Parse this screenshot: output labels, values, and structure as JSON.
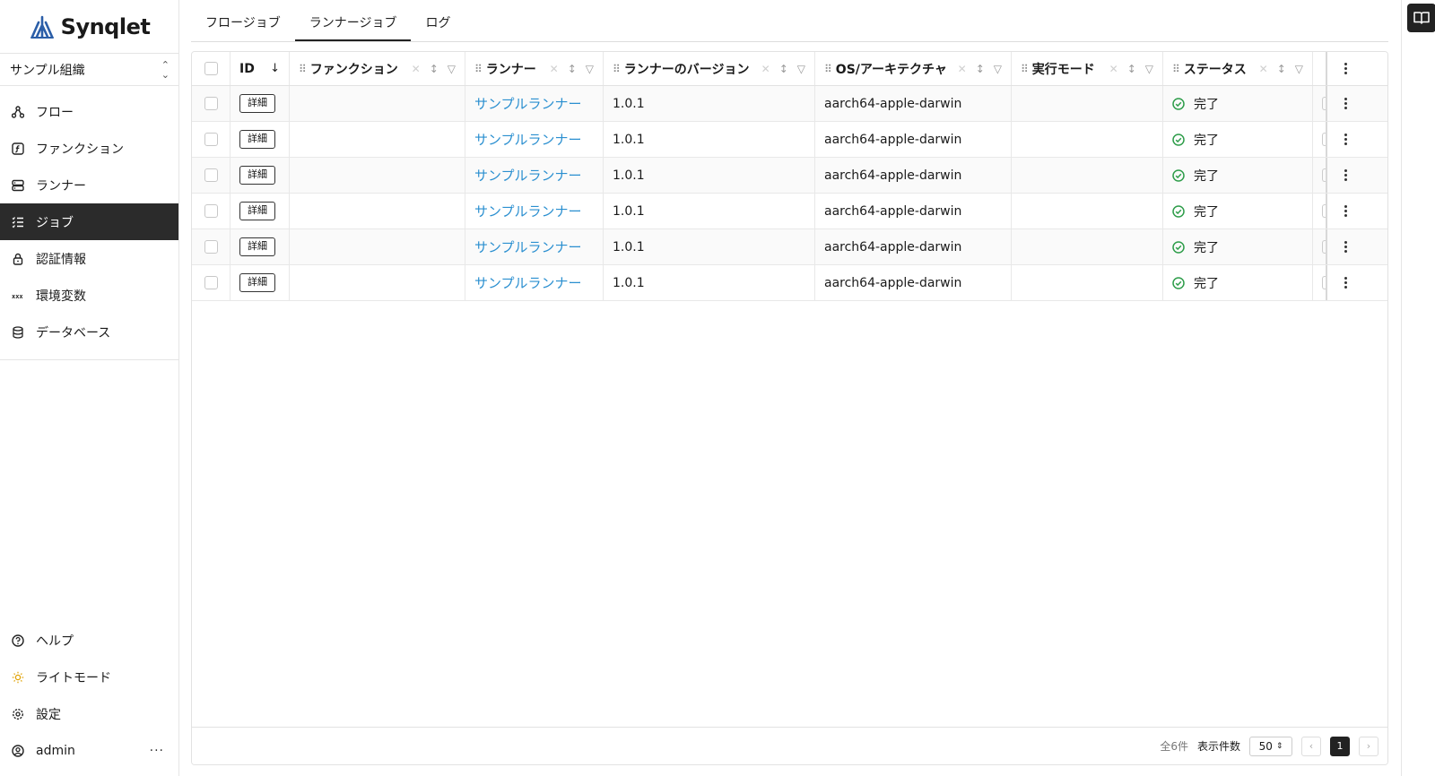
{
  "brand": {
    "name": "Synqlet",
    "accent": "#2b5ea8"
  },
  "org_selector": {
    "value": "サンプル組織",
    "icon": "chevron-updown-icon"
  },
  "sidebar": {
    "items": [
      {
        "label": "フロー",
        "icon": "flow-icon",
        "active": false
      },
      {
        "label": "ファンクション",
        "icon": "function-icon",
        "active": false
      },
      {
        "label": "ランナー",
        "icon": "server-icon",
        "active": false
      },
      {
        "label": "ジョブ",
        "icon": "list-check-icon",
        "active": true
      },
      {
        "label": "認証情報",
        "icon": "lock-icon",
        "active": false
      },
      {
        "label": "環境変数",
        "icon": "variable-icon",
        "active": false
      },
      {
        "label": "データベース",
        "icon": "database-icon",
        "active": false
      }
    ],
    "bottom": [
      {
        "label": "ヘルプ",
        "icon": "help-icon"
      },
      {
        "label": "ライトモード",
        "icon": "sun-icon"
      },
      {
        "label": "設定",
        "icon": "gear-icon"
      },
      {
        "label": "admin",
        "icon": "user-icon",
        "more": "···"
      }
    ]
  },
  "tabs": [
    {
      "label": "フロージョブ",
      "active": false
    },
    {
      "label": "ランナージョブ",
      "active": true
    },
    {
      "label": "ログ",
      "active": false
    }
  ],
  "table": {
    "columns": [
      {
        "label": "ID",
        "sort": "↓"
      },
      {
        "label": "ファンクション"
      },
      {
        "label": "ランナー"
      },
      {
        "label": "ランナーのバージョン"
      },
      {
        "label": "OS/アーキテクチャ"
      },
      {
        "label": "実行モード"
      },
      {
        "label": "ステータス"
      }
    ],
    "detail_label": "詳細",
    "rows": [
      {
        "function": "",
        "runner": "サンプルランナー",
        "version": "1.0.1",
        "os": "aarch64-apple-darwin",
        "mode": "",
        "status": "完了"
      },
      {
        "function": "",
        "runner": "サンプルランナー",
        "version": "1.0.1",
        "os": "aarch64-apple-darwin",
        "mode": "",
        "status": "完了"
      },
      {
        "function": "",
        "runner": "サンプルランナー",
        "version": "1.0.1",
        "os": "aarch64-apple-darwin",
        "mode": "",
        "status": "完了"
      },
      {
        "function": "",
        "runner": "サンプルランナー",
        "version": "1.0.1",
        "os": "aarch64-apple-darwin",
        "mode": "",
        "status": "完了"
      },
      {
        "function": "",
        "runner": "サンプルランナー",
        "version": "1.0.1",
        "os": "aarch64-apple-darwin",
        "mode": "",
        "status": "完了"
      },
      {
        "function": "",
        "runner": "サンプルランナー",
        "version": "1.0.1",
        "os": "aarch64-apple-darwin",
        "mode": "",
        "status": "完了"
      }
    ],
    "status_color": "#2e9d4a",
    "link_color": "#2a8fd0"
  },
  "footer": {
    "total": "全6件",
    "page_size_label": "表示件数",
    "page_size": "50",
    "prev": "‹",
    "next": "›",
    "page": "1"
  }
}
